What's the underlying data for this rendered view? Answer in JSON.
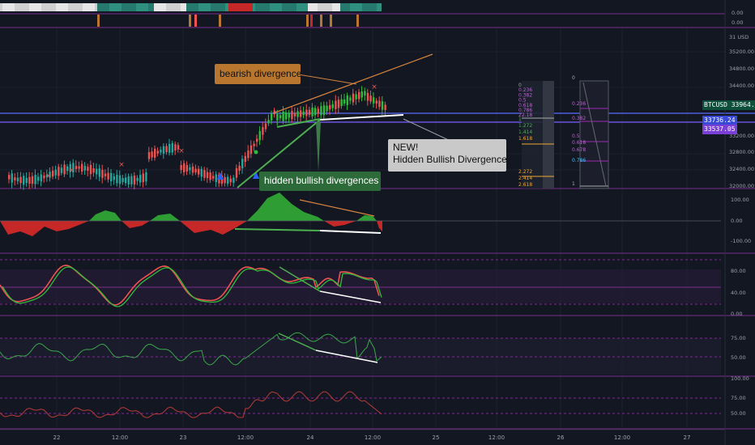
{
  "symbol": "BTCUSD",
  "colors": {
    "background": "#131722",
    "grid": "#1c2030",
    "up": "#26a69a",
    "up_bright": "#2ebd3a",
    "down": "#ef5350",
    "purple": "#9c27b0",
    "blue_line": "#5b6cff",
    "white_line": "#ffffff",
    "orange_line": "#d6843f",
    "green_line": "#4caf50",
    "axis_text": "#9ba0ad",
    "osc_green": "#2e9e34",
    "osc_red": "#c62828"
  },
  "x_axis": {
    "labels": [
      "22",
      "12:00",
      "23",
      "12:00",
      "24",
      "12:00",
      "25",
      "12:00",
      "26",
      "12:00",
      "27"
    ]
  },
  "price_axis": {
    "top_labels": [
      "0.00",
      "0.00"
    ],
    "labels": [
      "31 USD",
      "35200.00",
      "34800.00",
      "34400.00",
      "33964.86",
      "33736.24",
      "33537.05",
      "33200.00",
      "32800.00",
      "32400.00",
      "32000.00"
    ],
    "last_price": "33964.86",
    "line_price_1": "33736.24",
    "line_price_2": "33537.05"
  },
  "pane_labels": {
    "osc1": [
      "100.00",
      "0.00",
      "-100.00"
    ],
    "osc2": [
      "80.00",
      "40.00",
      "0.00"
    ],
    "osc3": [
      "75.00",
      "50.00"
    ],
    "osc4": [
      "100.00",
      "75.00",
      "50.00"
    ]
  },
  "fib_left": {
    "top": [
      "0",
      "0.236",
      "0.382",
      "0.5",
      "0.618",
      "0.786",
      "22.18"
    ],
    "mid": [
      "1",
      "1.272",
      "1.414",
      "1.618"
    ],
    "bot": [
      "2.272",
      "2.414",
      "2.618"
    ]
  },
  "fib_right": [
    "0",
    "0.236",
    "0.382",
    "0.5",
    "0.618",
    "0.678",
    "0.786",
    "1"
  ],
  "annotations": {
    "bearish": "bearish divergence",
    "hidden": "hidden bullish divergences",
    "new_line1": "NEW!",
    "new_line2": "Hidden Bullish Divergence"
  }
}
